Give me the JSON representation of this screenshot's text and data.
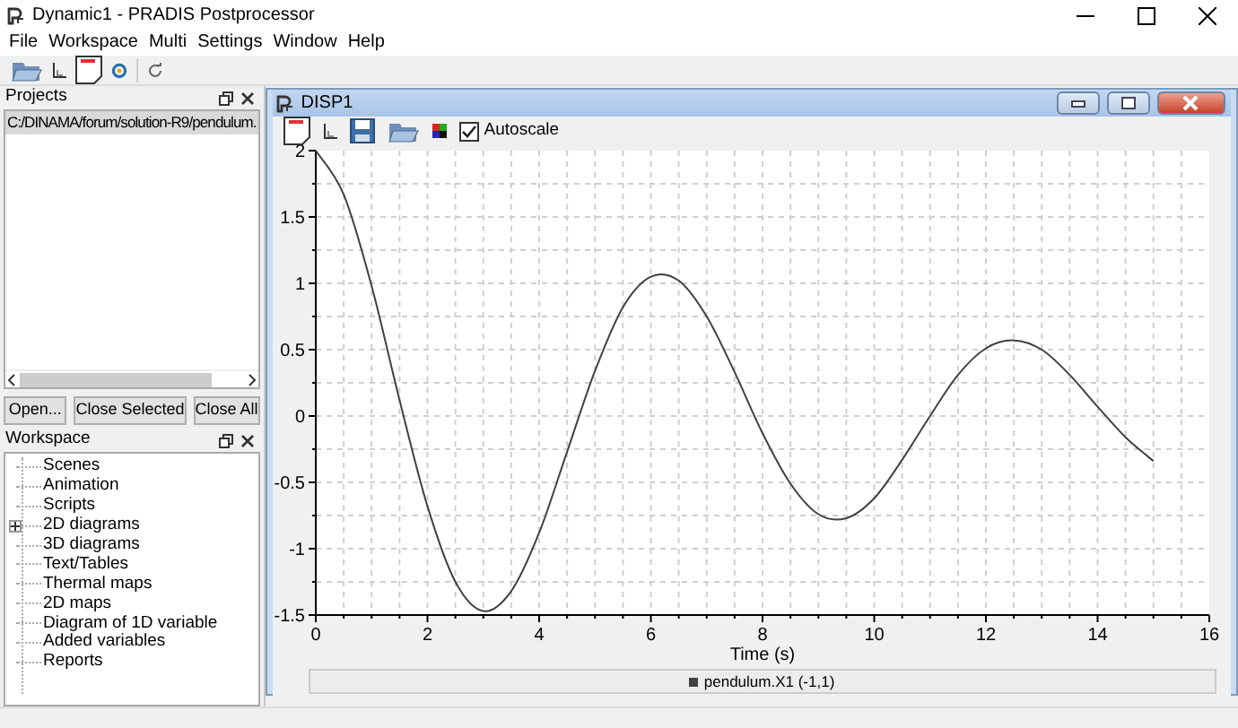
{
  "window": {
    "title": "Dynamic1 - PRADIS Postprocessor"
  },
  "menu": [
    "File",
    "Workspace",
    "Multi",
    "Settings",
    "Window",
    "Help"
  ],
  "projects": {
    "title": "Projects",
    "items": [
      {
        "label": "C:/DINAMA/forum/solution-R9/pendulum.",
        "selected": true
      }
    ],
    "buttons": [
      "Open...",
      "Close Selected",
      "Close All"
    ]
  },
  "workspace": {
    "title": "Workspace",
    "items": [
      {
        "label": "Scenes"
      },
      {
        "label": "Animation"
      },
      {
        "label": "Scripts"
      },
      {
        "label": "2D diagrams",
        "expanded": false
      },
      {
        "label": "3D diagrams"
      },
      {
        "label": "Text/Tables"
      },
      {
        "label": "Thermal maps"
      },
      {
        "label": "2D maps"
      },
      {
        "label": "Diagram of 1D variable"
      },
      {
        "label": "Added variables"
      },
      {
        "label": "Reports"
      }
    ]
  },
  "subwindow": {
    "title": "DISP1",
    "autoscale": {
      "label": "Autoscale",
      "checked": true
    },
    "chart_data": {
      "type": "line",
      "xlabel": "Time (s)",
      "x": [
        0,
        0.5,
        1,
        1.5,
        2,
        2.5,
        3,
        3.5,
        4,
        4.5,
        5,
        5.5,
        6,
        6.5,
        7,
        7.5,
        8,
        8.5,
        9,
        9.5,
        10,
        10.5,
        11,
        11.5,
        12,
        12.5,
        13,
        13.5,
        14,
        14.5,
        15
      ],
      "series": [
        {
          "name": "pendulum.X1 (-1,1)",
          "color": "#404040",
          "values": [
            2,
            1.67,
            0.98,
            0.12,
            -0.68,
            -1.25,
            -1.47,
            -1.32,
            -0.88,
            -0.27,
            0.34,
            0.82,
            1.05,
            1.02,
            0.75,
            0.33,
            -0.13,
            -0.51,
            -0.74,
            -0.77,
            -0.62,
            -0.33,
            0,
            0.31,
            0.51,
            0.57,
            0.5,
            0.31,
            0.07,
            -0.16,
            -0.34
          ]
        }
      ],
      "xlim": [
        0,
        16
      ],
      "ylim": [
        -1.5,
        2
      ],
      "xticks": [
        0,
        2,
        4,
        6,
        8,
        10,
        12,
        14,
        16
      ],
      "grid": true,
      "yticks": [
        -1.5,
        -1,
        -0.5,
        0,
        0.5,
        1,
        1.5,
        2
      ]
    }
  }
}
